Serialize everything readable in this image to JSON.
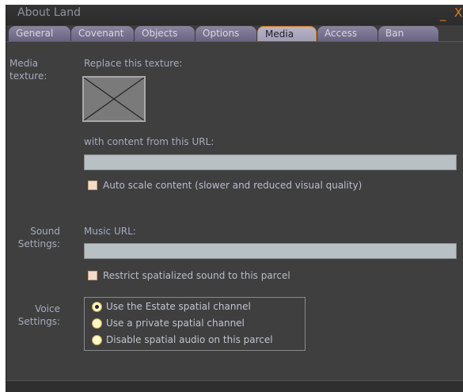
{
  "window": {
    "title": "About Land",
    "minimize_glyph": "_",
    "close_glyph": "X"
  },
  "tabs": [
    {
      "label": "General",
      "active": false
    },
    {
      "label": "Covenant",
      "active": false
    },
    {
      "label": "Objects",
      "active": false
    },
    {
      "label": "Options",
      "active": false
    },
    {
      "label": "Media",
      "active": true
    },
    {
      "label": "Access",
      "active": false
    },
    {
      "label": "Ban",
      "active": false
    }
  ],
  "media": {
    "section_label_line1": "Media",
    "section_label_line2": "texture:",
    "replace_texture_label": "Replace this texture:",
    "texture_icon": "missing-texture-icon",
    "content_url_label": "with content from this URL:",
    "content_url_value": "",
    "auto_scale_label": "Auto scale content (slower and reduced visual quality)",
    "auto_scale_checked": false
  },
  "sound": {
    "section_label_line1": "Sound",
    "section_label_line2": "Settings:",
    "music_url_label": "Music URL:",
    "music_url_value": "",
    "restrict_label": "Restrict spatialized sound to this parcel",
    "restrict_checked": false
  },
  "voice": {
    "section_label_line1": "Voice",
    "section_label_line2": "Settings:",
    "options": [
      {
        "label": "Use the Estate spatial channel",
        "selected": true
      },
      {
        "label": "Use a private spatial channel",
        "selected": false
      },
      {
        "label": "Disable spatial audio on this parcel",
        "selected": false
      }
    ]
  },
  "colors": {
    "background": "#3f3f3f",
    "accent": "#e08a2c",
    "tab_inactive": "#7a7391",
    "tab_active": "#aca8bd",
    "field": "#b9c0c3"
  }
}
